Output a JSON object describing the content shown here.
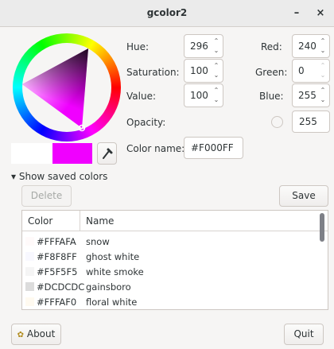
{
  "window": {
    "title": "gcolor2",
    "minimize": "–",
    "close": "×"
  },
  "fields": {
    "hue": {
      "label": "Hue:",
      "value": "296"
    },
    "saturation": {
      "label": "Saturation:",
      "value": "100"
    },
    "value": {
      "label": "Value:",
      "value": "100"
    },
    "red": {
      "label": "Red:",
      "value": "240"
    },
    "green": {
      "label": "Green:",
      "value": "0"
    },
    "blue": {
      "label": "Blue:",
      "value": "255"
    },
    "opacity": {
      "label": "Opacity:",
      "value": "255"
    },
    "color_name": {
      "label": "Color name:",
      "value": "#F000FF"
    }
  },
  "swatch": {
    "previous": "#ffffff",
    "current": "#f000ff"
  },
  "saved": {
    "expander_label": "Show saved colors",
    "expander_arrow": "▾",
    "delete_label": "Delete",
    "save_label": "Save",
    "columns": [
      "Color",
      "Name"
    ],
    "rows": [
      {
        "hex": "#FFFAFA",
        "name": "snow",
        "color": "#fffafa"
      },
      {
        "hex": "#F8F8FF",
        "name": "ghost white",
        "color": "#f8f8ff"
      },
      {
        "hex": "#F5F5F5",
        "name": "white smoke",
        "color": "#f5f5f5"
      },
      {
        "hex": "#DCDCDC",
        "name": "gainsboro",
        "color": "#dcdcdc"
      },
      {
        "hex": "#FFFAF0",
        "name": "floral white",
        "color": "#fffaf0"
      }
    ]
  },
  "footer": {
    "about_label": "About",
    "quit_label": "Quit"
  },
  "icons": {
    "spin_up": "⌃",
    "spin_down": "⌄",
    "about": "✿"
  }
}
